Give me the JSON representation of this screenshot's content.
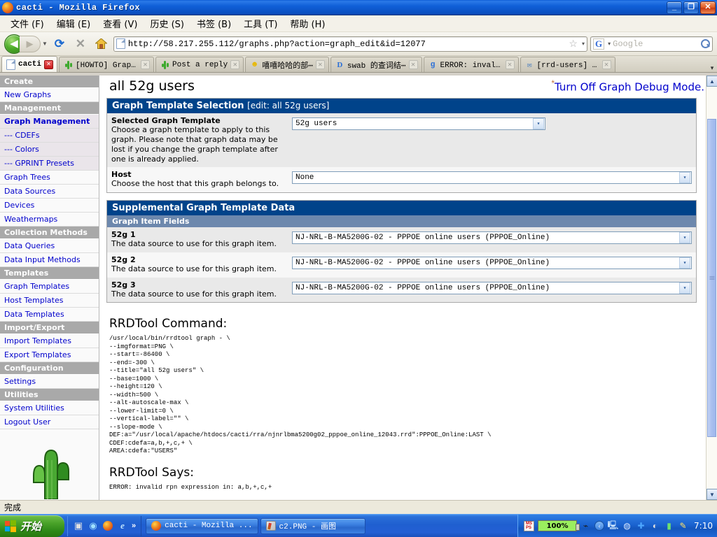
{
  "window": {
    "title": "cacti - Mozilla Firefox",
    "icon": "firefox-icon",
    "minimize_label": "_",
    "maximize_label": "❐",
    "close_label": "✕"
  },
  "menubar": {
    "items": [
      {
        "label": "文件 (F)"
      },
      {
        "label": "编辑 (E)"
      },
      {
        "label": "查看 (V)"
      },
      {
        "label": "历史 (S)"
      },
      {
        "label": "书签 (B)"
      },
      {
        "label": "工具 (T)"
      },
      {
        "label": "帮助 (H)"
      }
    ]
  },
  "toolbar": {
    "back_label": "◀",
    "forward_label": "▶",
    "history_dropdown_label": "▼",
    "reload_label": "⟳",
    "stop_label": "✕",
    "home_label": "⌂",
    "url": "http://58.217.255.112/graphs.php?action=graph_edit&id=12077",
    "bookmark_star": "☆",
    "url_dropdown": "▾",
    "search_engine": "G",
    "search_engine_dropdown": "▾",
    "search_placeholder": "Google",
    "search_value": ""
  },
  "tabs": {
    "list": [
      {
        "label": "cacti",
        "favicon": "document-icon",
        "active": true,
        "close_label": "✕"
      },
      {
        "label": "[HOWTO] Graph⋯",
        "favicon": "cactus-icon",
        "active": false,
        "close_label": "✕"
      },
      {
        "label": "Post a reply",
        "favicon": "cactus-icon",
        "active": false,
        "close_label": "✕"
      },
      {
        "label": "嘻嘻哈哈的部⋯",
        "favicon": "smiley-icon",
        "active": false,
        "close_label": "✕"
      },
      {
        "label": "swab 的查词结⋯",
        "favicon": "dict-icon",
        "active": false,
        "close_label": "✕"
      },
      {
        "label": "ERROR: invali⋯",
        "favicon": "google-icon",
        "active": false,
        "close_label": "✕"
      },
      {
        "label": "[rrd-users] C⋯",
        "favicon": "mail-icon",
        "active": false,
        "close_label": "✕"
      }
    ],
    "list_all_label": "▾"
  },
  "sidebar": {
    "items": [
      {
        "label": "Create",
        "type": "header"
      },
      {
        "label": "New Graphs",
        "type": "link"
      },
      {
        "label": "Management",
        "type": "header"
      },
      {
        "label": "Graph Management",
        "type": "selected"
      },
      {
        "label": "--- CDEFs",
        "type": "child"
      },
      {
        "label": "--- Colors",
        "type": "child"
      },
      {
        "label": "--- GPRINT Presets",
        "type": "child"
      },
      {
        "label": "Graph Trees",
        "type": "link"
      },
      {
        "label": "Data Sources",
        "type": "link"
      },
      {
        "label": "Devices",
        "type": "link"
      },
      {
        "label": "Weathermaps",
        "type": "link"
      },
      {
        "label": "Collection Methods",
        "type": "header"
      },
      {
        "label": "Data Queries",
        "type": "link"
      },
      {
        "label": "Data Input Methods",
        "type": "link"
      },
      {
        "label": "Templates",
        "type": "header"
      },
      {
        "label": "Graph Templates",
        "type": "link"
      },
      {
        "label": "Host Templates",
        "type": "link"
      },
      {
        "label": "Data Templates",
        "type": "link"
      },
      {
        "label": "Import/Export",
        "type": "header"
      },
      {
        "label": "Import Templates",
        "type": "link"
      },
      {
        "label": "Export Templates",
        "type": "link"
      },
      {
        "label": "Configuration",
        "type": "header"
      },
      {
        "label": "Settings",
        "type": "link"
      },
      {
        "label": "Utilities",
        "type": "header"
      },
      {
        "label": "System Utilities",
        "type": "link"
      },
      {
        "label": "Logout User",
        "type": "link"
      }
    ],
    "logo_alt": "cactus-logo"
  },
  "page": {
    "title": "all 52g users",
    "debug_link": "Turn Off Graph Debug Mode.",
    "debug_marker": "*"
  },
  "template_panel": {
    "title_main": "Graph Template Selection",
    "title_sub": "[edit: all 52g users]",
    "rows": [
      {
        "name": "Selected Graph Template",
        "desc": "Choose a graph template to apply to this graph. Please note that graph data may be lost if you change the graph template after one is already applied.",
        "value": "52g users",
        "arrow": "▾"
      },
      {
        "name": "Host",
        "desc": "Choose the host that this graph belongs to.",
        "value": "None",
        "arrow": "▾"
      }
    ]
  },
  "supplemental_panel": {
    "title": "Supplemental Graph Template Data",
    "subhead": "Graph Item Fields",
    "rows": [
      {
        "name": "52g 1",
        "desc": "The data source to use for this graph item.",
        "value": "NJ-NRL-B-MA5200G-02 - PPPOE online users (PPPOE_Online)",
        "arrow": "▾"
      },
      {
        "name": "52g 2",
        "desc": "The data source to use for this graph item.",
        "value": "NJ-NRL-B-MA5200G-02 - PPPOE online users (PPPOE_Online)",
        "arrow": "▾"
      },
      {
        "name": "52g 3",
        "desc": "The data source to use for this graph item.",
        "value": "NJ-NRL-B-MA5200G-02 - PPPOE online users (PPPOE_Online)",
        "arrow": "▾"
      }
    ]
  },
  "rrdtool": {
    "command_heading": "RRDTool Command:",
    "command_text": "/usr/local/bin/rrdtool graph - \\\n--imgformat=PNG \\\n--start=-86400 \\\n--end=-300 \\\n--title=\"all 52g users\" \\\n--base=1000 \\\n--height=120 \\\n--width=500 \\\n--alt-autoscale-max \\\n--lower-limit=0 \\\n--vertical-label=\"\" \\\n--slope-mode \\\nDEF:a=\"/usr/local/apache/htdocs/cacti/rra/njnrlbma5200g02_pppoe_online_12043.rrd\":PPPOE_Online:LAST \\\nCDEF:cdefa=a,b,+,c,+ \\\nAREA:cdefa:\"USERS\"",
    "says_heading": "RRDTool Says:",
    "says_text": "ERROR: invalid rpn expression in: a,b,+,c,+"
  },
  "scrollbar": {
    "up_label": "▲",
    "down_label": "▼"
  },
  "statusbar": {
    "text": "完成"
  },
  "taskbar": {
    "start_label": "开始",
    "quicklaunch": [
      {
        "name": "show-desktop-icon",
        "glyph": "▣"
      },
      {
        "name": "media-player-icon",
        "glyph": "◉"
      },
      {
        "name": "firefox-icon",
        "glyph": "●"
      },
      {
        "name": "internet-explorer-icon",
        "glyph": "e"
      }
    ],
    "quicklaunch_more": "»",
    "windows": [
      {
        "label": "cacti - Mozilla ...",
        "icon": "firefox-icon",
        "active": true
      },
      {
        "label": "c2.PNG - 画图",
        "icon": "paint-icon",
        "active": false
      }
    ],
    "tray": {
      "msn_icon": "msn-icon",
      "battery_label": "100%",
      "power_icon": "power-plug-icon",
      "icons": [
        {
          "name": "tray-expand-icon",
          "glyph": "‹"
        },
        {
          "name": "network-icon",
          "glyph": "🖧"
        },
        {
          "name": "globe-icon",
          "glyph": "◍"
        },
        {
          "name": "bluetooth-icon",
          "glyph": "✚"
        },
        {
          "name": "disc-icon",
          "glyph": "◐"
        },
        {
          "name": "signal-icon",
          "glyph": "▮"
        },
        {
          "name": "pencil-icon",
          "glyph": "✎"
        }
      ],
      "clock": "7:10"
    }
  }
}
